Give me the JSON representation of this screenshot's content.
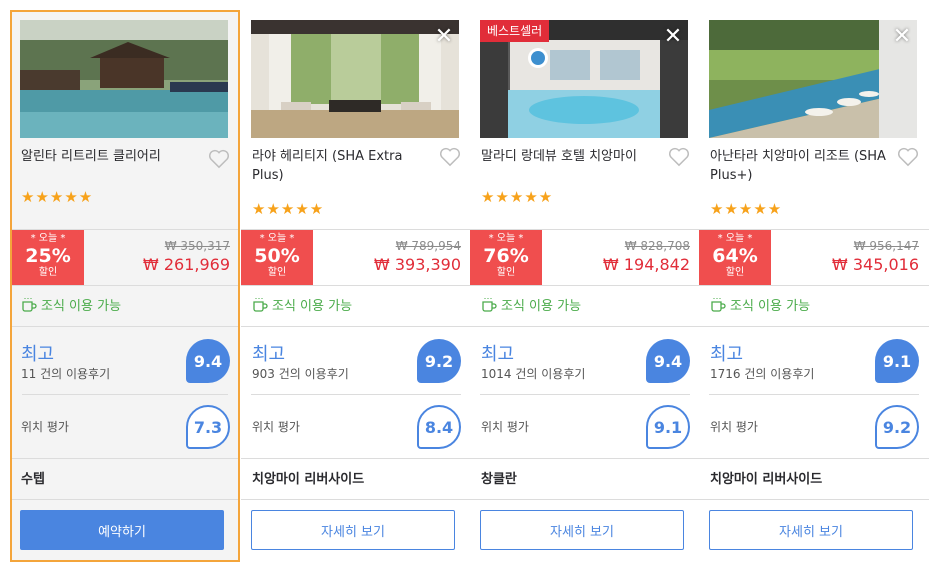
{
  "hotels": [
    {
      "name": "알린타 리트리트 클리어리",
      "stars": "★★★★★",
      "badge": "",
      "deal_today": "* 오늘 *",
      "deal_percent": "25%",
      "deal_label": "할인",
      "original_price": "₩ 350,317",
      "price": "₩ 261,969",
      "breakfast": "조식 이용 가능",
      "rating_word": "최고",
      "review_count": "11 건의 이용후기",
      "score": "9.4",
      "location_label": "위치 평가",
      "location_score": "7.3",
      "district": "수텝",
      "button": "예약하기"
    },
    {
      "name": "라야 헤리티지 (SHA Extra Plus)",
      "stars": "★★★★★",
      "badge": "",
      "deal_today": "* 오늘 *",
      "deal_percent": "50%",
      "deal_label": "할인",
      "original_price": "₩ 789,954",
      "price": "₩ 393,390",
      "breakfast": "조식 이용 가능",
      "rating_word": "최고",
      "review_count": "903 건의 이용후기",
      "score": "9.2",
      "location_label": "위치 평가",
      "location_score": "8.4",
      "district": "치앙마이 리버사이드",
      "button": "자세히 보기"
    },
    {
      "name": "말라디 랑데뷰 호텔 치앙마이",
      "stars": "★★★★★",
      "badge": "베스트셀러",
      "deal_today": "* 오늘 *",
      "deal_percent": "76%",
      "deal_label": "할인",
      "original_price": "₩ 828,708",
      "price": "₩ 194,842",
      "breakfast": "조식 이용 가능",
      "rating_word": "최고",
      "review_count": "1014 건의 이용후기",
      "score": "9.4",
      "location_label": "위치 평가",
      "location_score": "9.1",
      "district": "창클란",
      "button": "자세히 보기"
    },
    {
      "name": "아난타라 치앙마이 리조트 (SHA Plus+)",
      "stars": "★★★★★",
      "badge": "",
      "deal_today": "* 오늘 *",
      "deal_percent": "64%",
      "deal_label": "할인",
      "original_price": "₩ 956,147",
      "price": "₩ 345,016",
      "breakfast": "조식 이용 가능",
      "rating_word": "최고",
      "review_count": "1716 건의 이용후기",
      "score": "9.1",
      "location_label": "위치 평가",
      "location_score": "9.2",
      "district": "치앙마이 리버사이드",
      "button": "자세히 보기"
    }
  ],
  "icons": {
    "close": "close-icon",
    "favorite": "heart-icon",
    "breakfast": "coffee-cup-icon"
  },
  "colors": {
    "accent": "#4a85e0",
    "deal": "#f04e4e",
    "price": "#e12d39",
    "selected_border": "#f4a53b",
    "breakfast": "#4aab4a",
    "star": "#f7a21b"
  },
  "close_symbol": "✕"
}
